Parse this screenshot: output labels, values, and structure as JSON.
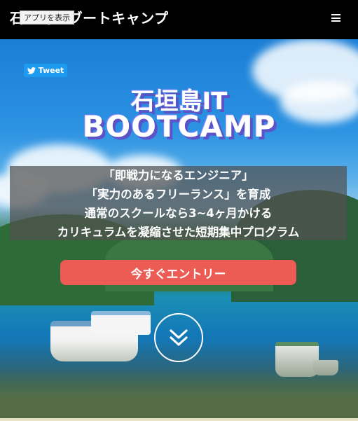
{
  "header": {
    "brand_text": "石垣島ITブートキャンプ",
    "tooltip_text": "アプリを表示",
    "menu_icon": "hamburger-icon"
  },
  "social": {
    "tweet_label": "Tweet"
  },
  "hero": {
    "title_line1": "石垣島IT",
    "title_line2": "BOOTCAMP",
    "tagline": [
      "「即戦力になるエンジニア」",
      "「実力のあるフリーランス」を育成",
      "通常のスクールなら3~4ヶ月かける",
      "カリキュラムを凝縮させた短期集中プログラム"
    ],
    "cta_label": "今すぐエントリー",
    "scroll_icon": "double-chevron-down-icon"
  },
  "colors": {
    "cta": "#ec5c55",
    "tweet": "#1d9bf0",
    "title_shadow": "#5c53c8"
  }
}
